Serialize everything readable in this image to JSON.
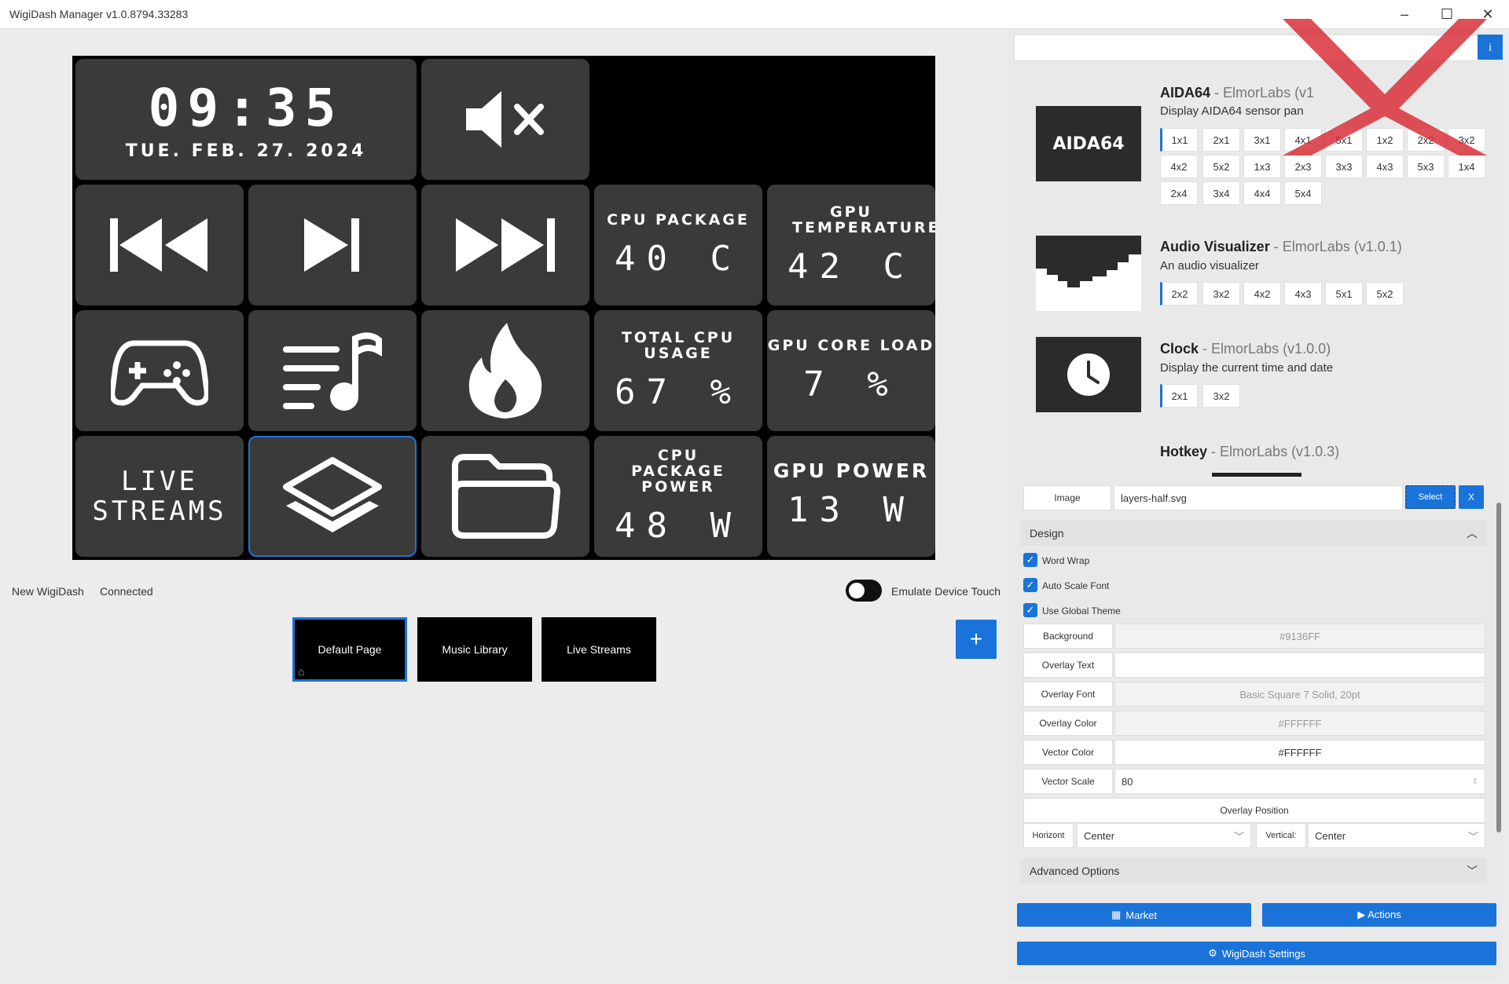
{
  "window": {
    "title": "WigiDash Manager v1.0.8794.33283"
  },
  "device_screen": {
    "clock": {
      "time": "09:35",
      "date": "TUE. FEB. 27. 2024"
    },
    "sensors": [
      {
        "label": "CPU PACKAGE",
        "value": "40 C"
      },
      {
        "label": "GPU TEMPERATURE",
        "value": "42 C"
      },
      {
        "label": "TOTAL CPU USAGE",
        "value": "67 %"
      },
      {
        "label": "GPU CORE LOAD",
        "value": "7 %"
      },
      {
        "label": "CPU PACKAGE POWER",
        "value": "48 W"
      },
      {
        "label": "GPU POWER",
        "value": "13 W"
      }
    ],
    "live_streams_label": "LIVE STREAMS"
  },
  "status": {
    "device": "New WigiDash",
    "connection": "Connected",
    "emulate_label": "Emulate Device Touch"
  },
  "pages": [
    "Default Page",
    "Music Library",
    "Live Streams"
  ],
  "add_page_label": "+",
  "plugins": [
    {
      "name": "AIDA64",
      "author": " - ElmorLabs (v1",
      "desc": "Display AIDA64 sensor pan",
      "logo_text": "AIDA64",
      "sizes": [
        "1x1",
        "2x1",
        "3x1",
        "4x1",
        "5x1",
        "1x2",
        "2x2",
        "3x2",
        "4x2",
        "5x2",
        "1x3",
        "2x3",
        "3x3",
        "4x3",
        "5x3",
        "1x4",
        "2x4",
        "3x4",
        "4x4",
        "5x4"
      ]
    },
    {
      "name": "Audio Visualizer",
      "author": " - ElmorLabs (v1.0.1)",
      "desc": "An audio visualizer",
      "sizes": [
        "2x2",
        "3x2",
        "4x2",
        "4x3",
        "5x1",
        "5x2"
      ]
    },
    {
      "name": "Clock",
      "author": " - ElmorLabs (v1.0.0)",
      "desc": "Display the current time and date",
      "sizes": [
        "2x1",
        "3x2"
      ]
    },
    {
      "name": "Hotkey",
      "author": " - ElmorLabs (v1.0.3)"
    }
  ],
  "properties": {
    "image": {
      "label": "Image",
      "value": "layers-half.svg",
      "select": "Select",
      "clear": "X"
    },
    "design_header": "Design",
    "checks": [
      "Word Wrap",
      "Auto Scale Font",
      "Use Global Theme"
    ],
    "background": {
      "label": "Background",
      "value": "#9136FF"
    },
    "overlay_text": {
      "label": "Overlay Text",
      "value": ""
    },
    "overlay_font": {
      "label": "Overlay Font",
      "value": "Basic Square 7 Solid, 20pt"
    },
    "overlay_color": {
      "label": "Overlay Color",
      "value": "#FFFFFF"
    },
    "vector_color": {
      "label": "Vector Color",
      "value": "#FFFFFF"
    },
    "vector_scale": {
      "label": "Vector Scale",
      "value": "80"
    },
    "overlay_position": "Overlay Position",
    "horizontal": {
      "label": "Horizont",
      "value": "Center"
    },
    "vertical": {
      "label": "Vertical:",
      "value": "Center"
    },
    "advanced": "Advanced Options"
  },
  "buttons": {
    "market": "Market",
    "actions": "▶ Actions",
    "settings": "WigiDash Settings"
  },
  "colors": {
    "accent": "#1a73d9",
    "tile": "#3a3a3a",
    "watermark": "#d9303a"
  }
}
